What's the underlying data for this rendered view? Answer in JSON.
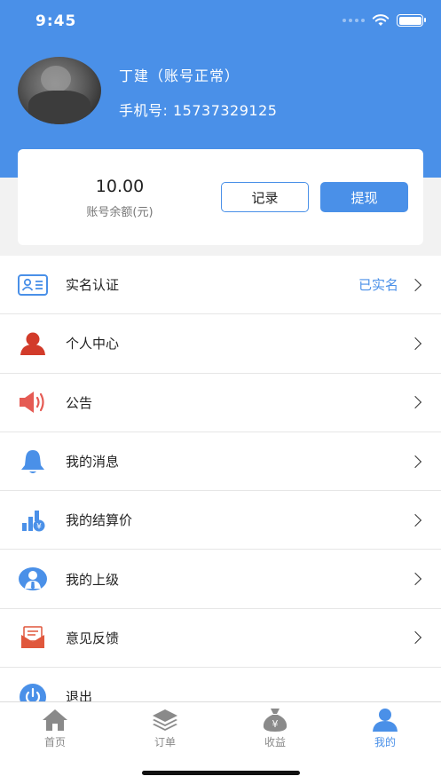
{
  "status_bar": {
    "time": "9:45"
  },
  "profile": {
    "name": "丁建（账号正常）",
    "phone": "手机号: 15737329125"
  },
  "account": {
    "balance": "10.00",
    "balance_label": "账号余额(元)",
    "record_label": "记录",
    "withdraw_label": "提现"
  },
  "menu": {
    "items": [
      {
        "label": "实名认证",
        "extra": "已实名",
        "icon": "id-card-icon"
      },
      {
        "label": "个人中心",
        "icon": "person-icon"
      },
      {
        "label": "公告",
        "icon": "speaker-icon"
      },
      {
        "label": "我的消息",
        "icon": "bell-icon"
      },
      {
        "label": "我的结算价",
        "icon": "settlement-chart-icon"
      },
      {
        "label": "我的上级",
        "icon": "supervisor-icon"
      },
      {
        "label": "意见反馈",
        "icon": "feedback-mail-icon"
      },
      {
        "label": "退出",
        "icon": "power-icon"
      }
    ]
  },
  "tabbar": {
    "tabs": [
      {
        "label": "首页",
        "icon": "home-icon"
      },
      {
        "label": "订单",
        "icon": "layers-icon"
      },
      {
        "label": "收益",
        "icon": "money-bag-icon"
      },
      {
        "label": "我的",
        "icon": "user-icon",
        "active": true
      }
    ]
  },
  "colors": {
    "brand": "#4a90e8",
    "danger_red": "#d23b2a",
    "speaker_red": "#e55b54",
    "feedback_orange": "#e0573c"
  }
}
